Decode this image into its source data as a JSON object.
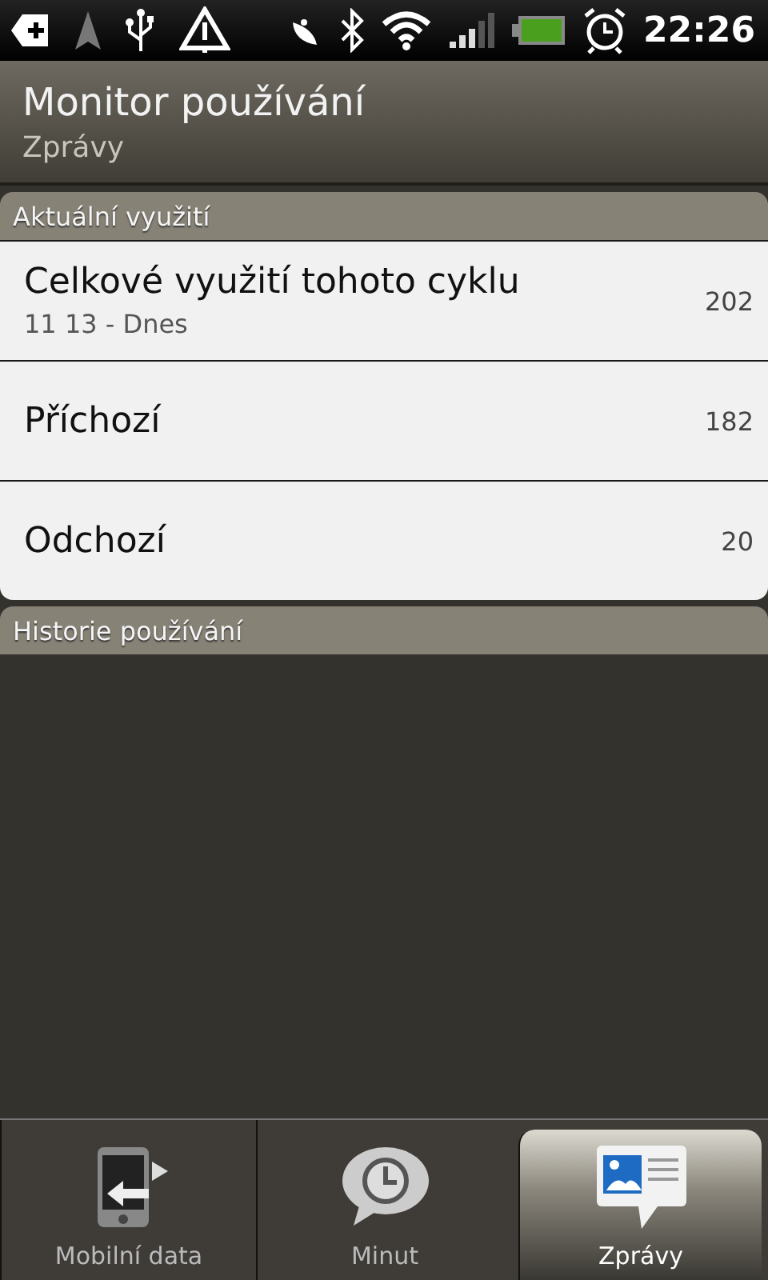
{
  "status_bar": {
    "time": "22:26"
  },
  "header": {
    "title": "Monitor používání",
    "subtitle": "Zprávy"
  },
  "sections": [
    {
      "title": "Aktuální využití",
      "rows": [
        {
          "label": "Celkové využití tohoto cyklu",
          "sublabel": "11 13 - Dnes",
          "value": "202"
        },
        {
          "label": "Příchozí",
          "value": "182"
        },
        {
          "label": "Odchozí",
          "value": "20"
        }
      ]
    },
    {
      "title": "Historie používání"
    }
  ],
  "tabs": [
    {
      "label": "Mobilní data",
      "selected": false
    },
    {
      "label": "Minut",
      "selected": false
    },
    {
      "label": "Zprávy",
      "selected": true
    }
  ]
}
